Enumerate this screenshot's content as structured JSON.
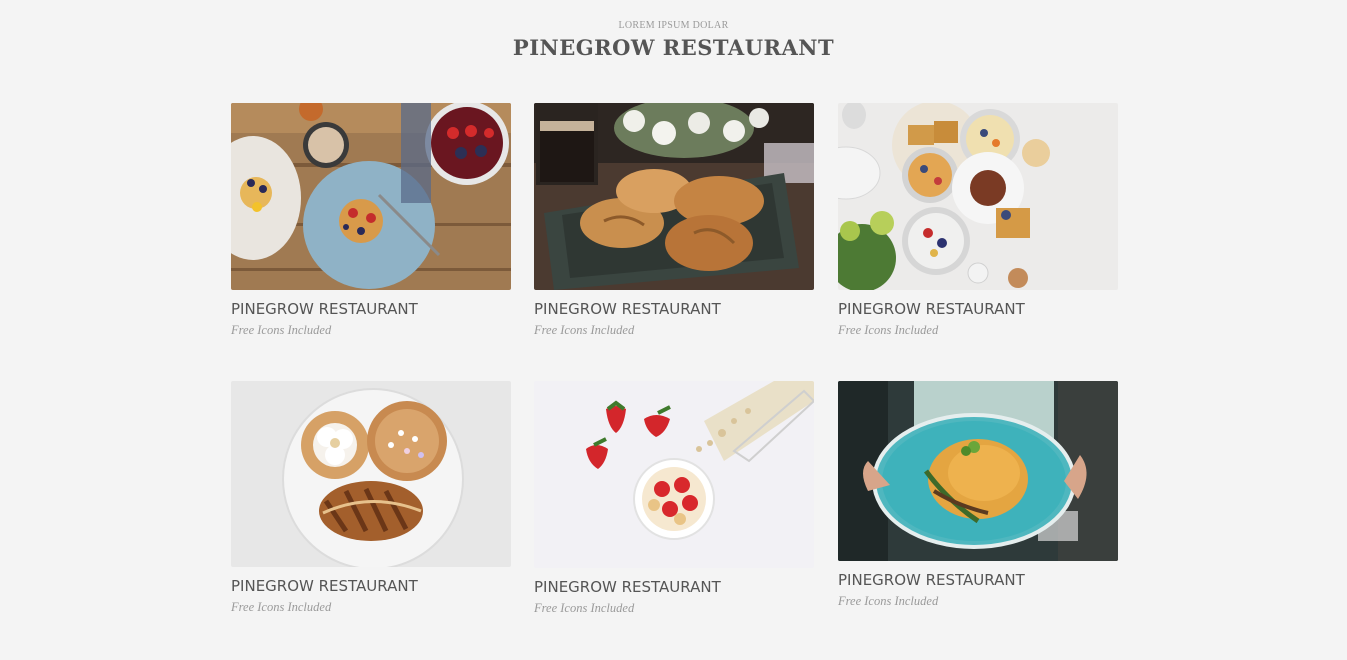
{
  "header": {
    "eyebrow": "LOREM IPSUM DOLAR",
    "title": "PINEGROW RESTAURANT"
  },
  "cards": [
    {
      "title": "PINEGROW RESTAURANT",
      "subtitle": "Free Icons Included",
      "image": "breakfast-pancakes-photo"
    },
    {
      "title": "PINEGROW RESTAURANT",
      "subtitle": "Free Icons Included",
      "image": "croissants-photo"
    },
    {
      "title": "PINEGROW RESTAURANT",
      "subtitle": "Free Icons Included",
      "image": "brunch-spread-photo"
    },
    {
      "title": "PINEGROW RESTAURANT",
      "subtitle": "Free Icons Included",
      "image": "pastries-plate-photo"
    },
    {
      "title": "PINEGROW RESTAURANT",
      "subtitle": "Free Icons Included",
      "image": "strawberries-yogurt-photo"
    },
    {
      "title": "PINEGROW RESTAURANT",
      "subtitle": "Free Icons Included",
      "image": "omelette-plate-photo"
    }
  ]
}
